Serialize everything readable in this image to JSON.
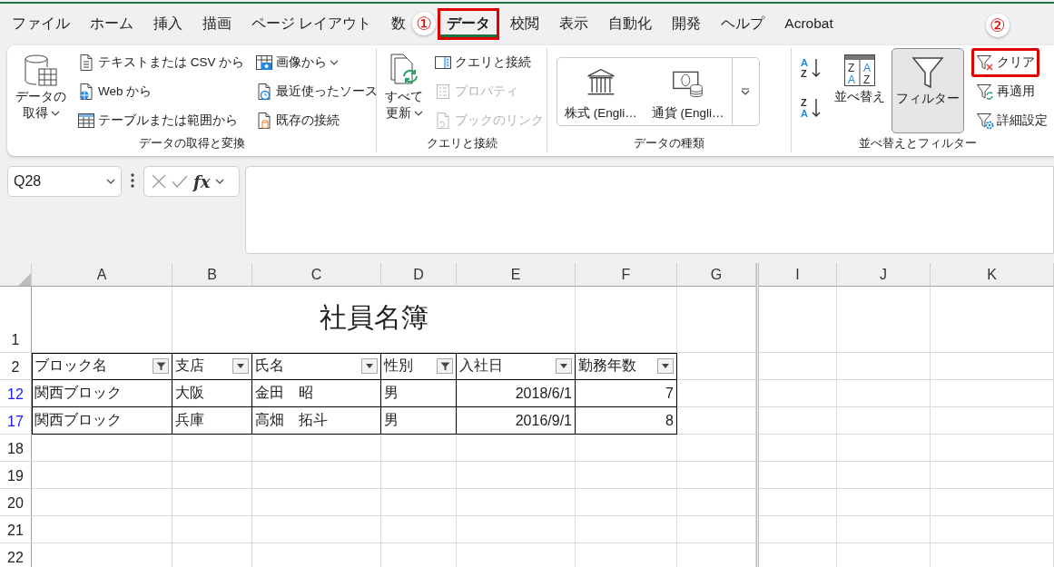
{
  "tabs": [
    {
      "label": "ファイル",
      "selected": false,
      "highlighted": false
    },
    {
      "label": "ホーム",
      "selected": false,
      "highlighted": false
    },
    {
      "label": "挿入",
      "selected": false,
      "highlighted": false
    },
    {
      "label": "描画",
      "selected": false,
      "highlighted": false
    },
    {
      "label": "ページ レイアウト",
      "selected": false,
      "highlighted": false
    },
    {
      "label": "数",
      "selected": false,
      "highlighted": false
    },
    {
      "label": "データ",
      "selected": true,
      "highlighted": true,
      "callout": "①"
    },
    {
      "label": "校閲",
      "selected": false,
      "highlighted": false
    },
    {
      "label": "表示",
      "selected": false,
      "highlighted": false
    },
    {
      "label": "自動化",
      "selected": false,
      "highlighted": false
    },
    {
      "label": "開発",
      "selected": false,
      "highlighted": false
    },
    {
      "label": "ヘルプ",
      "selected": false,
      "highlighted": false
    },
    {
      "label": "Acrobat",
      "selected": false,
      "highlighted": false
    }
  ],
  "ribbon": {
    "groups": [
      {
        "label": "データの取得と変換",
        "columns": [
          [
            {
              "kind": "large",
              "lines": [
                "データの",
                "取得"
              ],
              "dropdown": true,
              "disabled": false,
              "pressed": false,
              "highlighted": false
            }
          ],
          [
            {
              "kind": "small",
              "label": "テキストまたは CSV から",
              "dropdown": false,
              "disabled": false,
              "pressed": false,
              "highlighted": false
            },
            {
              "kind": "small",
              "label": "Web から",
              "dropdown": false,
              "disabled": false,
              "pressed": false,
              "highlighted": false
            },
            {
              "kind": "small",
              "label": "テーブルまたは範囲から",
              "dropdown": false,
              "disabled": false,
              "pressed": false,
              "highlighted": false
            }
          ],
          [
            {
              "kind": "small",
              "label": "画像から",
              "dropdown": true,
              "disabled": false,
              "pressed": false,
              "highlighted": false
            },
            {
              "kind": "small",
              "label": "最近使ったソース",
              "dropdown": false,
              "disabled": false,
              "pressed": false,
              "highlighted": false
            },
            {
              "kind": "small",
              "label": "既存の接続",
              "dropdown": false,
              "disabled": false,
              "pressed": false,
              "highlighted": false
            }
          ]
        ]
      },
      {
        "label": "クエリと接続",
        "columns": [
          [
            {
              "kind": "large",
              "lines": [
                "すべて",
                "更新"
              ],
              "dropdown": true,
              "disabled": false,
              "pressed": false,
              "highlighted": false
            }
          ],
          [
            {
              "kind": "small",
              "label": "クエリと接続",
              "dropdown": false,
              "disabled": false,
              "pressed": false,
              "highlighted": false
            },
            {
              "kind": "small",
              "label": "プロパティ",
              "dropdown": false,
              "disabled": true,
              "pressed": false,
              "highlighted": false
            },
            {
              "kind": "small",
              "label": "ブックのリンク",
              "dropdown": false,
              "disabled": true,
              "pressed": false,
              "highlighted": false
            }
          ]
        ]
      },
      {
        "label": "データの種類",
        "gallery": [
          {
            "label": "株式 (Engli…"
          },
          {
            "label": "通貨 (Engli…"
          }
        ]
      },
      {
        "label": "並べ替えとフィルター",
        "columns": [
          [
            {
              "kind": "icon",
              "icon_letters": [
                "A",
                "Z"
              ],
              "dropdown": false,
              "disabled": false,
              "pressed": false,
              "highlighted": false
            },
            {
              "kind": "icon",
              "icon_letters": [
                "Z",
                "A"
              ],
              "dropdown": false,
              "disabled": false,
              "pressed": false,
              "highlighted": false
            }
          ],
          [
            {
              "kind": "large",
              "label": "並べ替え",
              "icon_letters": [
                "Z",
                "A",
                "A",
                "Z"
              ],
              "dropdown": false,
              "disabled": false,
              "pressed": false,
              "highlighted": false
            }
          ],
          [
            {
              "kind": "large",
              "label": "フィルター",
              "dropdown": false,
              "disabled": false,
              "pressed": true,
              "highlighted": false
            }
          ],
          [
            {
              "kind": "small",
              "label": "クリア",
              "dropdown": false,
              "disabled": false,
              "pressed": false,
              "highlighted": true,
              "callout": "②"
            },
            {
              "kind": "small",
              "label": "再適用",
              "dropdown": false,
              "disabled": false,
              "pressed": false,
              "highlighted": false
            },
            {
              "kind": "small",
              "label": "詳細設定",
              "dropdown": false,
              "disabled": false,
              "pressed": false,
              "highlighted": false
            }
          ]
        ]
      }
    ]
  },
  "formula_bar": {
    "name_box": "Q28",
    "function_label": "fx"
  },
  "sheet": {
    "columns": [
      {
        "letter": "A",
        "hidden_next": false
      },
      {
        "letter": "B",
        "hidden_next": false
      },
      {
        "letter": "C",
        "hidden_next": false
      },
      {
        "letter": "D",
        "hidden_next": false
      },
      {
        "letter": "E",
        "hidden_next": false
      },
      {
        "letter": "F",
        "hidden_next": false
      },
      {
        "letter": "G",
        "hidden_next": true
      },
      {
        "letter": "I",
        "hidden_next": false
      },
      {
        "letter": "J",
        "hidden_next": false
      },
      {
        "letter": "K",
        "hidden_next": false
      }
    ],
    "rows": [
      {
        "number": "1",
        "kind": "title",
        "filtered": false,
        "title": "社員名簿"
      },
      {
        "number": "2",
        "kind": "header",
        "filtered": false,
        "cells": [
          {
            "text": "ブロック名",
            "filtered": true
          },
          {
            "text": "支店",
            "filtered": false
          },
          {
            "text": "氏名",
            "filtered": false
          },
          {
            "text": "性別",
            "filtered": true
          },
          {
            "text": "入社日",
            "filtered": false
          },
          {
            "text": "勤務年数",
            "filtered": false
          }
        ]
      },
      {
        "number": "12",
        "kind": "data",
        "filtered": true,
        "cells": [
          "関西ブロック",
          "大阪",
          "金田　昭",
          "男",
          "2018/6/1",
          "7"
        ]
      },
      {
        "number": "17",
        "kind": "data",
        "filtered": true,
        "cells": [
          "関西ブロック",
          "兵庫",
          "高畑　拓斗",
          "男",
          "2016/9/1",
          "8"
        ]
      },
      {
        "number": "18",
        "kind": "empty",
        "filtered": false
      },
      {
        "number": "19",
        "kind": "empty",
        "filtered": false
      },
      {
        "number": "20",
        "kind": "empty",
        "filtered": false
      },
      {
        "number": "21",
        "kind": "empty",
        "filtered": false
      },
      {
        "number": "22",
        "kind": "empty",
        "filtered": false
      }
    ]
  }
}
